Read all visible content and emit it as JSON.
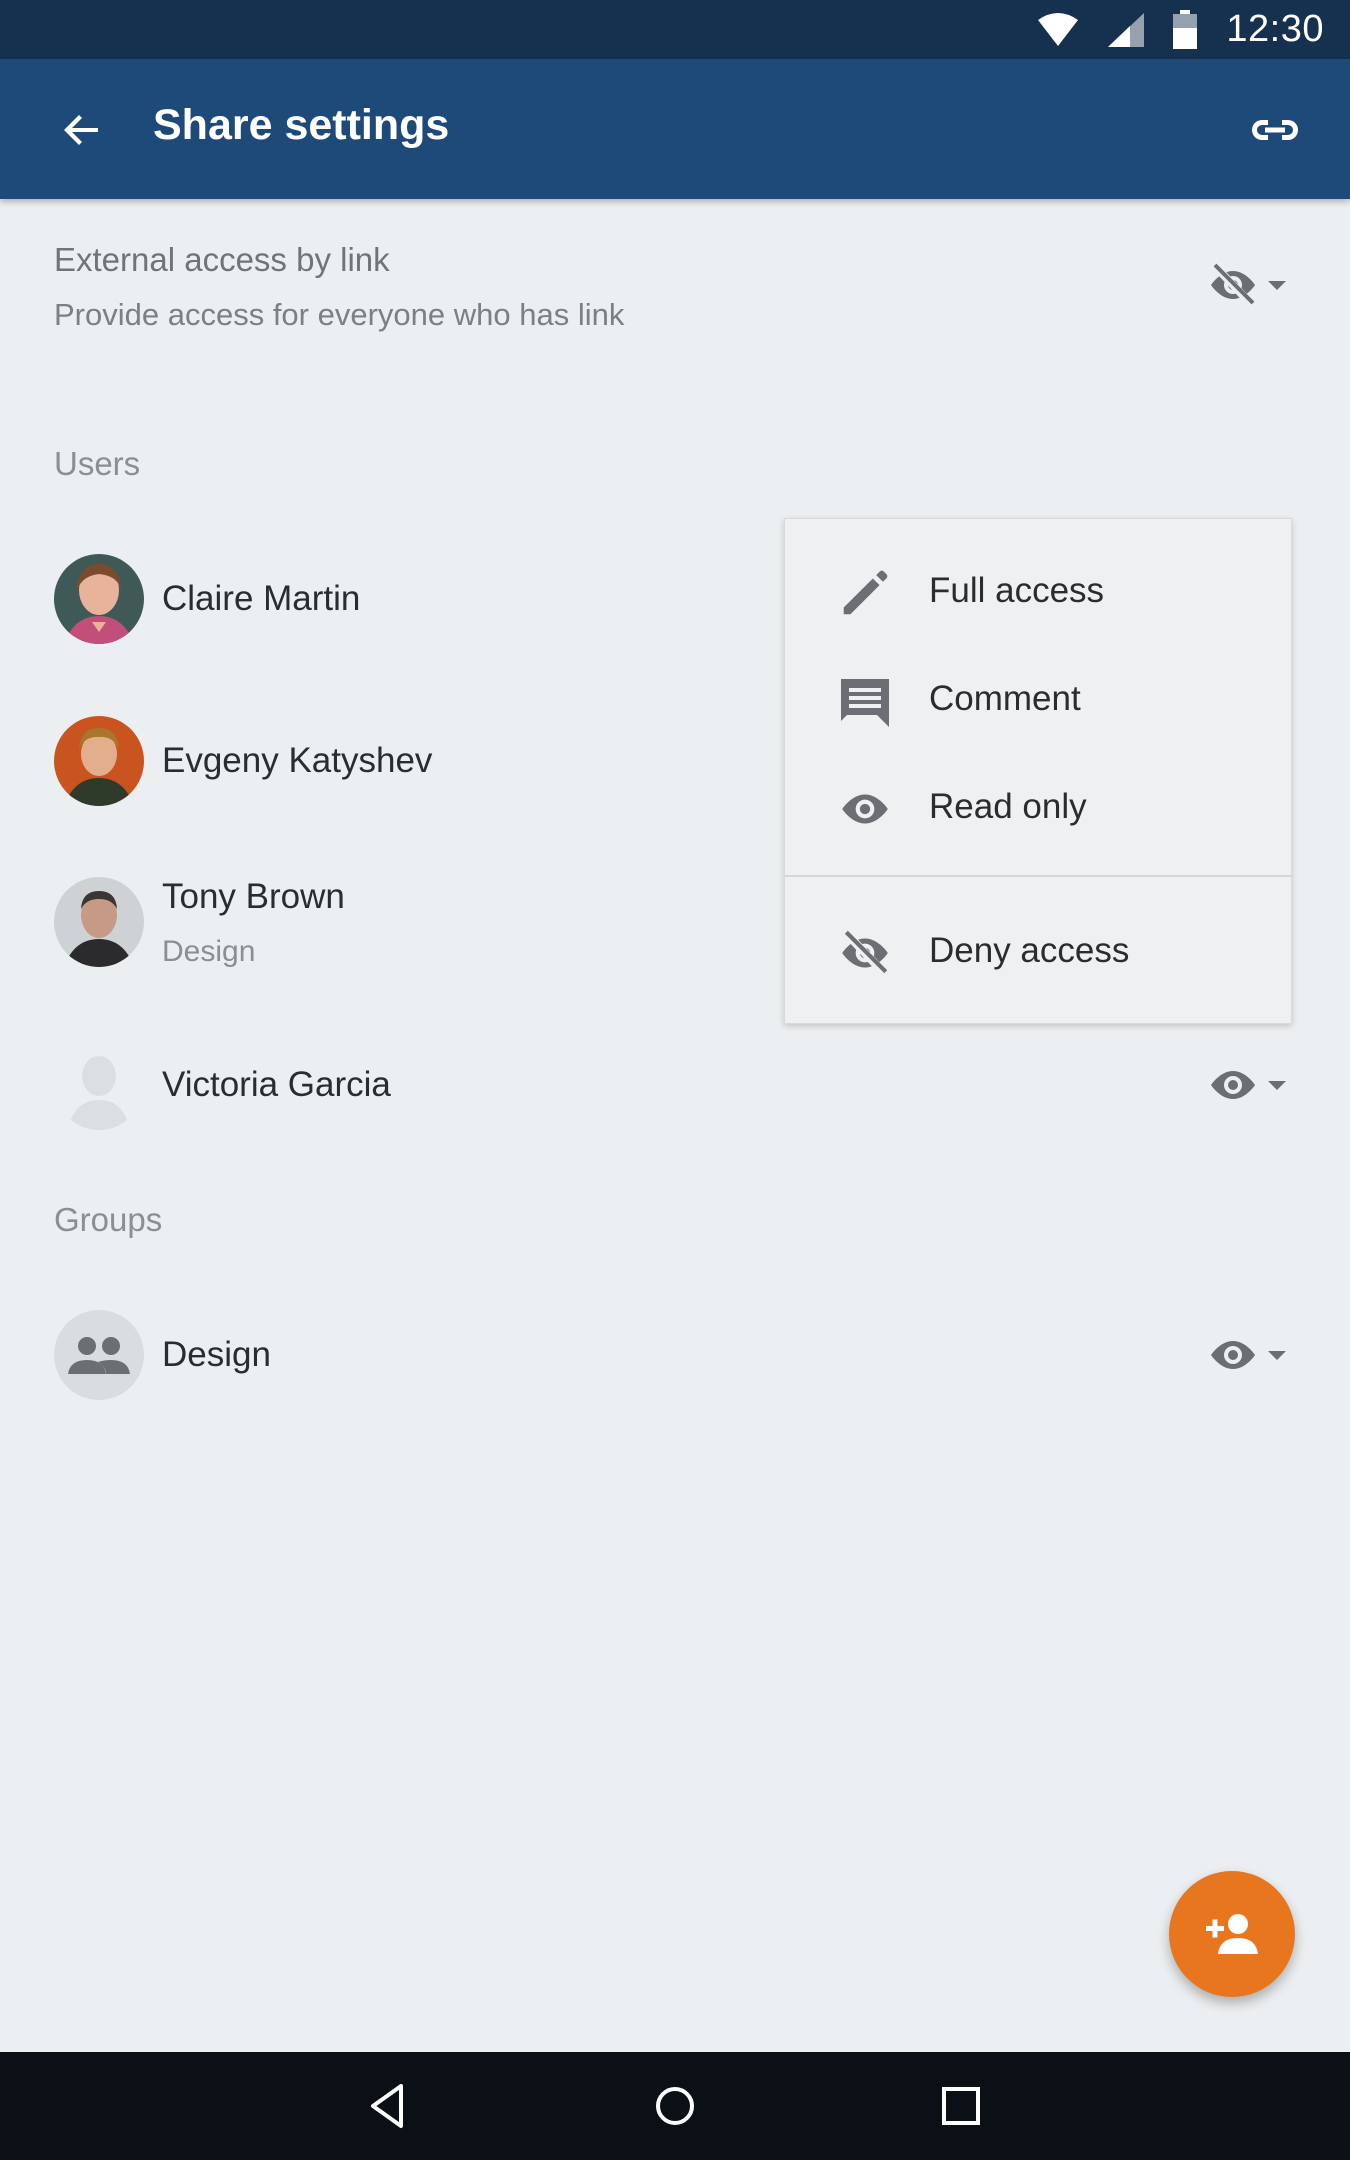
{
  "status_bar": {
    "time": "12:30",
    "icons": [
      "wifi-icon",
      "signal-icon",
      "battery-icon"
    ]
  },
  "app_bar": {
    "title": "Share settings",
    "back_icon": "arrow-back-icon",
    "action_icon": "link-icon"
  },
  "external_access": {
    "title": "External access by link",
    "subtitle": "Provide access for everyone who has link",
    "current_permission_icon": "eye-off-icon"
  },
  "users_section": {
    "label": "Users",
    "items": [
      {
        "name": "Claire Martin",
        "subtitle": "",
        "permission_icon": ""
      },
      {
        "name": "Evgeny Katyshev",
        "subtitle": "",
        "permission_icon": ""
      },
      {
        "name": "Tony Brown",
        "subtitle": "Design",
        "permission_icon": "pencil-icon"
      },
      {
        "name": "Victoria Garcia",
        "subtitle": "",
        "permission_icon": "eye-icon"
      }
    ]
  },
  "groups_section": {
    "label": "Groups",
    "items": [
      {
        "name": "Design",
        "permission_icon": "eye-icon"
      }
    ]
  },
  "permission_menu": {
    "items": [
      {
        "label": "Full access",
        "icon": "pencil-icon"
      },
      {
        "label": "Comment",
        "icon": "comment-icon"
      },
      {
        "label": "Read only",
        "icon": "eye-icon"
      },
      {
        "label": "Deny access",
        "icon": "eye-off-icon"
      }
    ]
  },
  "fab": {
    "icon": "person-add-icon"
  },
  "nav_bar": {
    "icons": [
      "nav-back-icon",
      "nav-home-icon",
      "nav-recents-icon"
    ]
  },
  "colors": {
    "status_bar": "#16304f",
    "app_bar": "#1d4a79",
    "background": "#eceff1",
    "fab": "#e8761e",
    "icon_gray": "#6b6f73"
  }
}
